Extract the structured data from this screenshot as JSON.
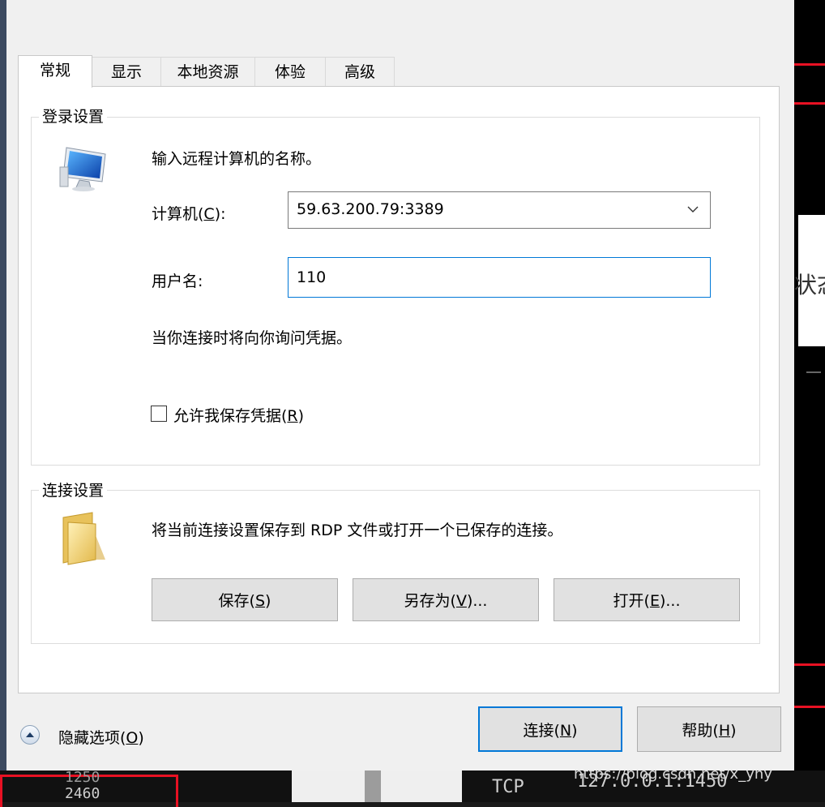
{
  "tabs": [
    {
      "label": "常规",
      "active": true
    },
    {
      "label": "显示",
      "active": false
    },
    {
      "label": "本地资源",
      "active": false
    },
    {
      "label": "体验",
      "active": false
    },
    {
      "label": "高级",
      "active": false
    }
  ],
  "login_settings": {
    "group_title": "登录设置",
    "icon": "computer-icon",
    "instruction": "输入远程计算机的名称。",
    "computer_label_prefix": "计算机(",
    "computer_label_accel": "C",
    "computer_label_suffix": "):",
    "computer_value": "59.63.200.79:3389",
    "username_label": "用户名:",
    "username_value": "110",
    "credential_note": "当你连接时将向你询问凭据。",
    "save_credentials_prefix": "允许我保存凭据(",
    "save_credentials_accel": "R",
    "save_credentials_suffix": ")",
    "save_credentials_checked": false
  },
  "connection_settings": {
    "group_title": "连接设置",
    "icon": "folder-icon",
    "description": "将当前连接设置保存到 RDP 文件或打开一个已保存的连接。",
    "save_prefix": "保存(",
    "save_accel": "S",
    "save_suffix": ")",
    "saveas_prefix": "另存为(",
    "saveas_accel": "V",
    "saveas_suffix": ")...",
    "open_prefix": "打开(",
    "open_accel": "E",
    "open_suffix": ")..."
  },
  "footer": {
    "hide_options_prefix": "隐藏选项(",
    "hide_options_accel": "O",
    "hide_options_suffix": ")",
    "connect_prefix": "连接(",
    "connect_accel": "N",
    "connect_suffix": ")",
    "help_prefix": "帮助(",
    "help_accel": "H",
    "help_suffix": ")"
  },
  "background": {
    "status_glyph": "状态",
    "num1": "1250",
    "num2": "2460",
    "protocol": "TCP",
    "address": "127.0.0.1:1450",
    "watermark": "https://blog.csdn.net/x_yhy"
  },
  "colors": {
    "accent": "#0078d7",
    "background_red": "#e81123"
  }
}
